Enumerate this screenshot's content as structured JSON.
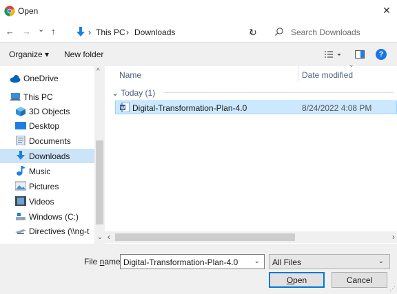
{
  "window": {
    "title": "Open",
    "close_glyph": "✕",
    "app_icon": "chrome-icon"
  },
  "nav": {
    "back_glyph": "←",
    "forward_glyph": "→",
    "recent_glyph": "⌄",
    "up_glyph": "↑",
    "address": {
      "segments": [
        "This PC",
        "Downloads"
      ],
      "separator": "›"
    },
    "refresh_glyph": "↻",
    "search": {
      "placeholder": "Search Downloads"
    }
  },
  "toolbar": {
    "organize_label": "Organize ▾",
    "new_folder_label": "New folder"
  },
  "sidebar": {
    "items": [
      {
        "label": "OneDrive",
        "icon": "cloud-icon"
      },
      {
        "label": "This PC",
        "icon": "computer-icon"
      },
      {
        "label": "3D Objects",
        "icon": "cube-icon"
      },
      {
        "label": "Desktop",
        "icon": "desktop-icon"
      },
      {
        "label": "Documents",
        "icon": "documents-icon"
      },
      {
        "label": "Downloads",
        "icon": "download-arrow-icon",
        "selected": true
      },
      {
        "label": "Music",
        "icon": "music-note-icon"
      },
      {
        "label": "Pictures",
        "icon": "pictures-icon"
      },
      {
        "label": "Videos",
        "icon": "videos-icon"
      },
      {
        "label": "Windows (C:)",
        "icon": "drive-icon"
      },
      {
        "label": "Directives (\\\\ng-t",
        "icon": "network-drive-icon"
      }
    ]
  },
  "columns": {
    "name": "Name",
    "date_modified": "Date modified"
  },
  "group": {
    "label": "Today (1)"
  },
  "files": [
    {
      "name": "Digital-Transformation-Plan-4.0",
      "date": "8/24/2022 4:08 PM",
      "icon": "word-document-icon"
    }
  ],
  "footer": {
    "file_name_label_pre": "File ",
    "file_name_label_u": "n",
    "file_name_label_post": "ame:",
    "file_name_value": "Digital-Transformation-Plan-4.0",
    "file_type_value": "All Files",
    "open_label_u": "O",
    "open_label_rest": "pen",
    "cancel_label": "Cancel"
  },
  "colors": {
    "selection": "#cce8ff",
    "sidebar_selection": "#cce4f7",
    "accent": "#0078d7",
    "help": "#1a73e8"
  }
}
